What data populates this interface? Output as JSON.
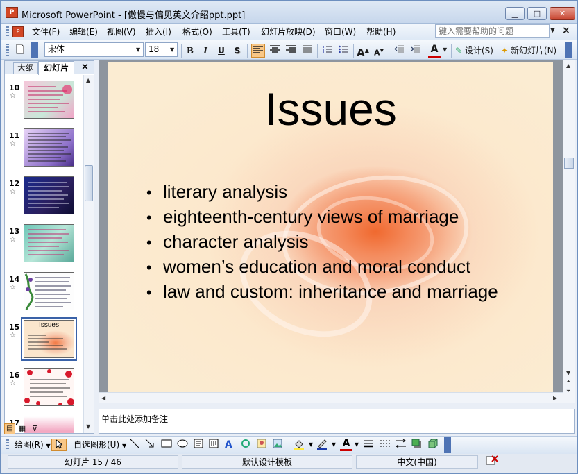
{
  "window": {
    "title": "Microsoft PowerPoint - [傲慢与偏见英文介绍ppt.ppt]",
    "app_icon_label": "P",
    "minimize": "▁",
    "maximize": "□",
    "close": "✕"
  },
  "menubar": {
    "items": [
      "文件(F)",
      "编辑(E)",
      "视图(V)",
      "插入(I)",
      "格式(O)",
      "工具(T)",
      "幻灯片放映(D)",
      "窗口(W)",
      "帮助(H)"
    ],
    "help_placeholder": "键入需要帮助的问题",
    "doc_close": "×"
  },
  "toolbar": {
    "font_name": "宋体",
    "font_size": "18",
    "bold": "B",
    "italic": "I",
    "underline": "U",
    "shadow": "S",
    "design_label": "设计(S)",
    "new_slide_label": "新幻灯片(N)",
    "font_color_letter": "A",
    "grow_font": "A",
    "shrink_font": "A"
  },
  "panel": {
    "tab_outline": "大纲",
    "tab_slides": "幻灯片",
    "close": "×",
    "slides": [
      {
        "number": "10",
        "theme": "pink"
      },
      {
        "number": "11",
        "theme": "purple"
      },
      {
        "number": "12",
        "theme": "navy"
      },
      {
        "number": "13",
        "theme": "teal"
      },
      {
        "number": "14",
        "theme": "white-vine"
      },
      {
        "number": "15",
        "theme": "rose",
        "title": "Issues",
        "selected": true
      },
      {
        "number": "16",
        "theme": "red-petals"
      },
      {
        "number": "17",
        "theme": "pink-fade"
      }
    ]
  },
  "slide": {
    "title": "Issues",
    "bullets": [
      "literary analysis",
      "eighteenth-century views of marriage",
      "character analysis",
      "women’s education and moral conduct",
      "law and custom: inheritance and marriage"
    ]
  },
  "notes": {
    "placeholder": "单击此处添加备注"
  },
  "drawbar": {
    "draw_label": "绘图(R)",
    "autoshapes_label": "自选图形(U)"
  },
  "status": {
    "slide_indicator": "幻灯片 15 / 46",
    "template": "默认设计模板",
    "language": "中文(中国)"
  }
}
